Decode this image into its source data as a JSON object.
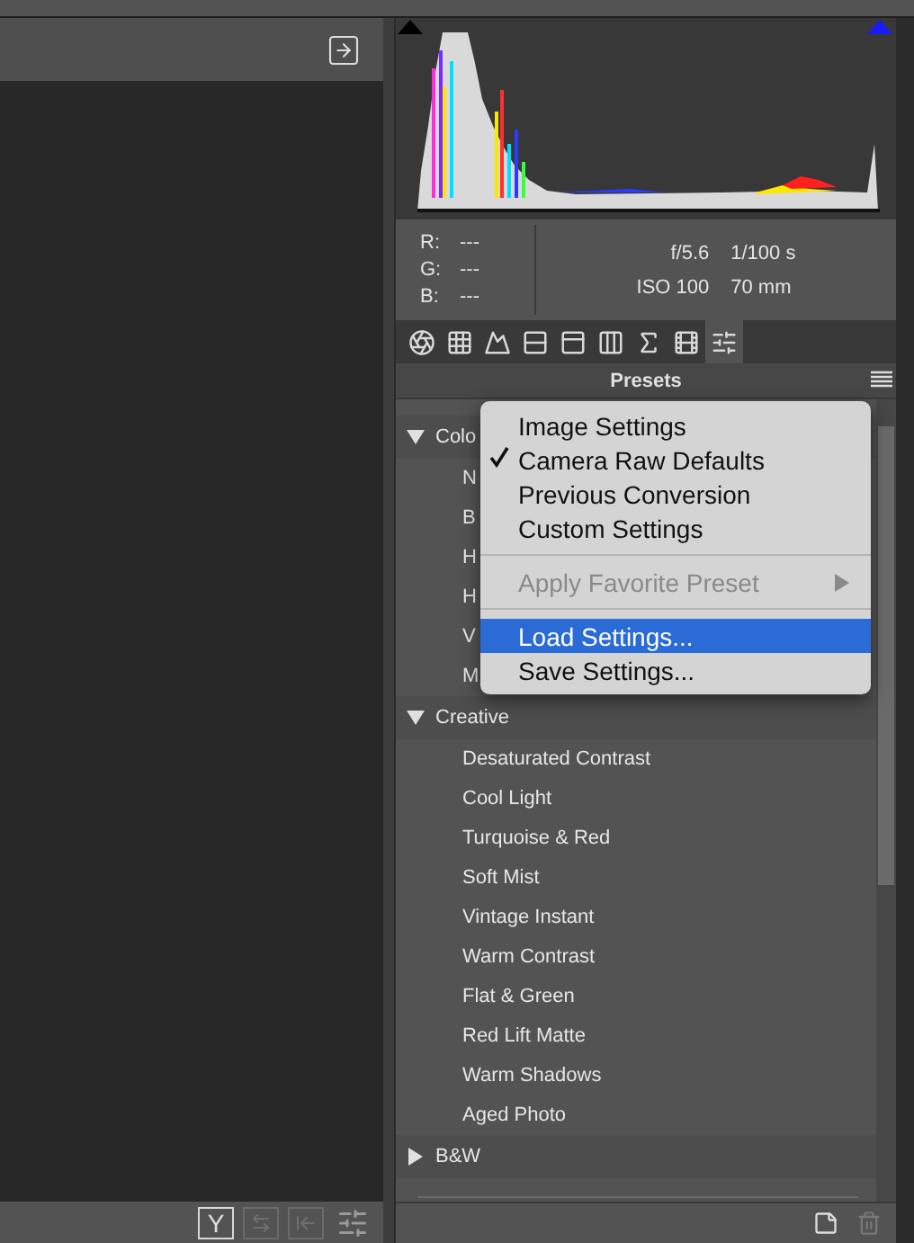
{
  "left_panel": {
    "view_button": "Y"
  },
  "histogram": {
    "readout": [
      {
        "channel": "R:",
        "value": "---"
      },
      {
        "channel": "G:",
        "value": "---"
      },
      {
        "channel": "B:",
        "value": "---"
      }
    ],
    "exposure": {
      "aperture": "f/5.6",
      "shutter": "1/100 s",
      "iso": "ISO 100",
      "focal_length": "70 mm"
    }
  },
  "panel_tabs": [
    {
      "selected": false
    },
    {
      "selected": false
    },
    {
      "selected": false
    },
    {
      "selected": false
    },
    {
      "selected": false
    },
    {
      "selected": false
    },
    {
      "selected": false
    },
    {
      "selected": false
    },
    {
      "selected": true
    }
  ],
  "presets": {
    "title": "Presets",
    "groups": [
      {
        "name": "Colo",
        "expanded": true,
        "items": [
          "N",
          "B",
          "H",
          "H",
          "V",
          "M"
        ]
      },
      {
        "name": "Creative",
        "expanded": true,
        "items": [
          "Desaturated Contrast",
          "Cool Light",
          "Turquoise & Red",
          "Soft Mist",
          "Vintage Instant",
          "Warm Contrast",
          "Flat & Green",
          "Red Lift Matte",
          "Warm Shadows",
          "Aged Photo"
        ]
      },
      {
        "name": "B&W",
        "expanded": false
      }
    ]
  },
  "menu": {
    "items": [
      {
        "kind": "item",
        "label": "Image Settings",
        "checked": false,
        "disabled": false,
        "selected": false
      },
      {
        "kind": "item",
        "label": "Camera Raw Defaults",
        "checked": true,
        "disabled": false,
        "selected": false
      },
      {
        "kind": "item",
        "label": "Previous Conversion",
        "checked": false,
        "disabled": false,
        "selected": false
      },
      {
        "kind": "item",
        "label": "Custom Settings",
        "checked": false,
        "disabled": false,
        "selected": false
      },
      {
        "kind": "separator"
      },
      {
        "kind": "submenu",
        "label": "Apply Favorite Preset",
        "checked": false,
        "disabled": true,
        "selected": false
      },
      {
        "kind": "separator"
      },
      {
        "kind": "item",
        "label": "Load Settings...",
        "checked": false,
        "disabled": false,
        "selected": true
      },
      {
        "kind": "item",
        "label": "Save Settings...",
        "checked": false,
        "disabled": false,
        "selected": false
      }
    ]
  }
}
